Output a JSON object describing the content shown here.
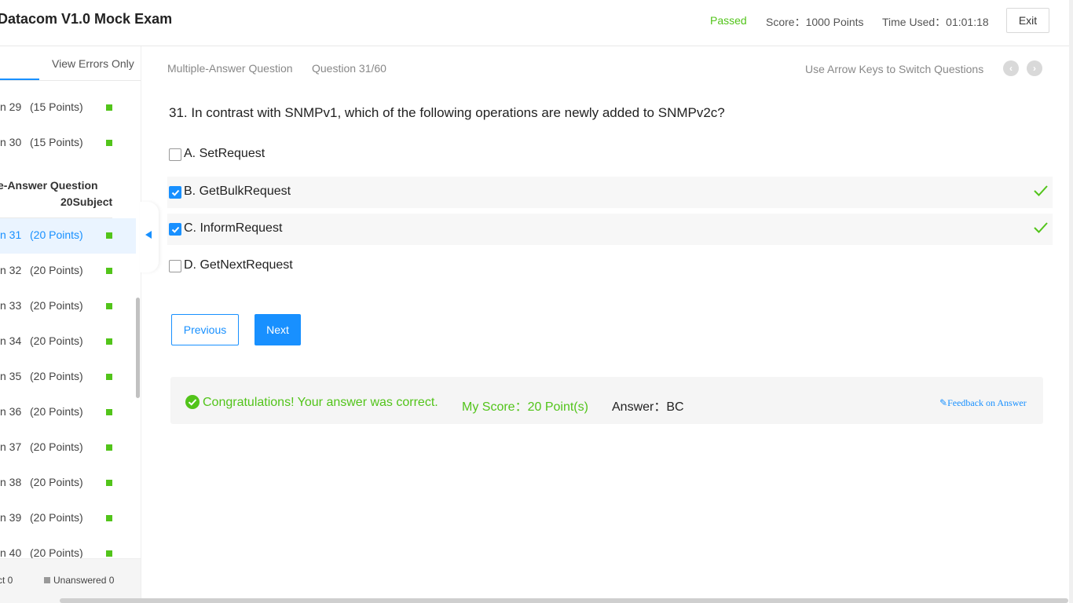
{
  "header": {
    "title": "Datacom V1.0 Mock Exam",
    "status": "Passed",
    "score": "Score：1000 Points",
    "time_used": "Time Used：01:01:18",
    "exit_label": "Exit"
  },
  "sidebar": {
    "tab_errors": "View Errors Only",
    "items_a": [
      {
        "num": "n 29",
        "pts": "(15 Points)"
      },
      {
        "num": "n 30",
        "pts": "(15 Points)"
      }
    ],
    "section_title": "e-Answer Question",
    "section_sub": "20Subject",
    "items_b": [
      {
        "num": "n 31",
        "pts": "(20 Points)"
      },
      {
        "num": "n 32",
        "pts": "(20 Points)"
      },
      {
        "num": "n 33",
        "pts": "(20 Points)"
      },
      {
        "num": "n 34",
        "pts": "(20 Points)"
      },
      {
        "num": "n 35",
        "pts": "(20 Points)"
      },
      {
        "num": "n 36",
        "pts": "(20 Points)"
      },
      {
        "num": "n 37",
        "pts": "(20 Points)"
      },
      {
        "num": "n 38",
        "pts": "(20 Points)"
      },
      {
        "num": "n 39",
        "pts": "(20 Points)"
      },
      {
        "num": "n 40",
        "pts": "(20 Points)"
      }
    ],
    "footer_correct": "ct 0",
    "footer_unanswered": "Unanswered 0"
  },
  "main": {
    "question_type": "Multiple-Answer Question",
    "question_count": "Question 31/60",
    "arrow_hint": "Use Arrow Keys to Switch Questions",
    "question_text": "31. In contrast with SNMPv1, which of the following operations are newly added to SNMPv2c?",
    "options": [
      {
        "text": "A. SetRequest",
        "selected": false
      },
      {
        "text": "B. GetBulkRequest",
        "selected": true
      },
      {
        "text": "C. InformRequest",
        "selected": true
      },
      {
        "text": "D. GetNextRequest",
        "selected": false
      }
    ],
    "prev_label": "Previous",
    "next_label": "Next",
    "result": {
      "congrats": "Congratulations! Your answer was correct.",
      "my_score": "My Score：20 Point(s)",
      "answer": "Answer：BC",
      "feedback": "Feedback on Answer"
    }
  },
  "colors": {
    "accent": "#1890ff",
    "success": "#52c41a"
  }
}
